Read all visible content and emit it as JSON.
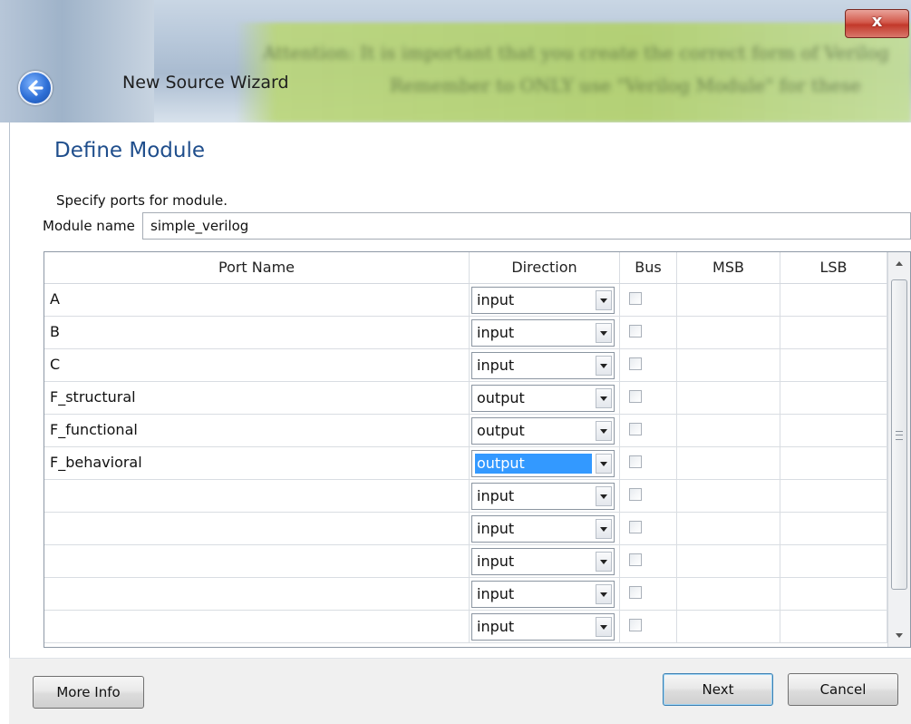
{
  "window": {
    "title": "New Source Wizard",
    "close_glyph": "x",
    "background_text_line1": "Attention: It is important that you create the correct form of Verilog",
    "background_text_line2": "Remember to ONLY use \"Verilog Module\" for these"
  },
  "page": {
    "title": "Define Module",
    "subtitle": "Specify ports for module."
  },
  "module": {
    "label": "Module name",
    "value": "simple_verilog"
  },
  "table": {
    "headers": {
      "port_name": "Port Name",
      "direction": "Direction",
      "bus": "Bus",
      "msb": "MSB",
      "lsb": "LSB"
    },
    "rows": [
      {
        "name": "A",
        "direction": "input",
        "bus": false,
        "msb": "",
        "lsb": ""
      },
      {
        "name": "B",
        "direction": "input",
        "bus": false,
        "msb": "",
        "lsb": ""
      },
      {
        "name": "C",
        "direction": "input",
        "bus": false,
        "msb": "",
        "lsb": ""
      },
      {
        "name": "F_structural",
        "direction": "output",
        "bus": false,
        "msb": "",
        "lsb": ""
      },
      {
        "name": "F_functional",
        "direction": "output",
        "bus": false,
        "msb": "",
        "lsb": ""
      },
      {
        "name": "F_behavioral",
        "direction": "output",
        "bus": false,
        "msb": "",
        "lsb": "",
        "selected": true
      },
      {
        "name": "",
        "direction": "input",
        "bus": false,
        "msb": "",
        "lsb": ""
      },
      {
        "name": "",
        "direction": "input",
        "bus": false,
        "msb": "",
        "lsb": ""
      },
      {
        "name": "",
        "direction": "input",
        "bus": false,
        "msb": "",
        "lsb": ""
      },
      {
        "name": "",
        "direction": "input",
        "bus": false,
        "msb": "",
        "lsb": ""
      },
      {
        "name": "",
        "direction": "input",
        "bus": false,
        "msb": "",
        "lsb": ""
      }
    ]
  },
  "buttons": {
    "more_info": "More Info",
    "next": "Next",
    "cancel": "Cancel"
  },
  "icons": {
    "back": "back-arrow-icon",
    "close": "close-icon",
    "dropdown": "chevron-down-icon",
    "scroll_up": "scroll-up-arrow-icon",
    "scroll_down": "scroll-down-arrow-icon"
  },
  "colors": {
    "page_title": "#1f4e8c",
    "selection": "#3399ff",
    "close_button": "#c2382a"
  }
}
